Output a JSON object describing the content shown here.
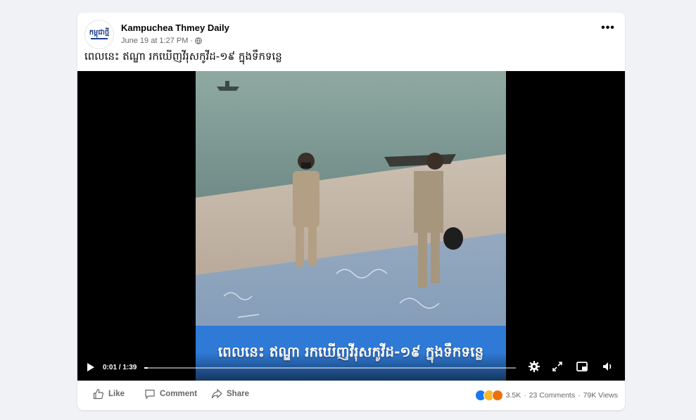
{
  "post": {
    "page_name": "Kampuchea Thmey Daily",
    "logo_text": "កម្ពុជាថ្មី",
    "timestamp": "June 19 at 1:27 PM",
    "timestamp_separator": "·",
    "privacy_icon": "globe-icon",
    "more_icon": "more-options-icon",
    "more_label": "•••",
    "caption": "ពេលនេះ ឥណ្ឌា រកឃើញវីរុសកូវីដ-១៩ ក្នុងទឹកទន្លេ"
  },
  "video": {
    "subtitle": "ពេលនេះ ឥណ្ឌា រកឃើញវីរុសកូវីដ-១៩ ក្នុងទឹកទន្លេ",
    "time_display": "0:01 / 1:39",
    "progress_fraction": 0.01,
    "controls": [
      "play-icon",
      "settings-icon",
      "fullscreen-icon",
      "picture-in-picture-icon",
      "volume-icon"
    ]
  },
  "footer": {
    "like_label": "Like",
    "comment_label": "Comment",
    "share_label": "Share",
    "reactions_count": "3.5K",
    "comments_count": "23 Comments",
    "views_count": "79K Views",
    "separator": "·"
  },
  "colors": {
    "background": "#f0f2f5",
    "card": "#ffffff",
    "subtitle_band": "#2f7ad6",
    "secondary_text": "#65676b",
    "like_blue": "#1877f2"
  }
}
